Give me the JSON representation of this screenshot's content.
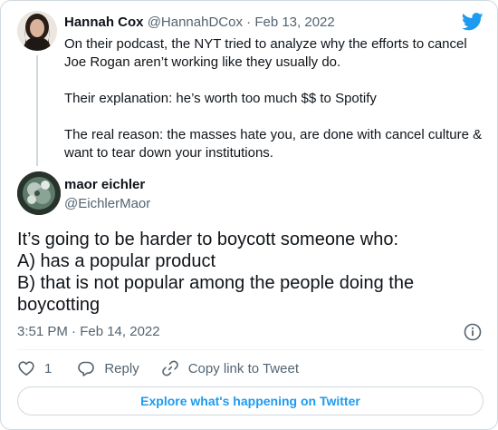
{
  "parent_tweet": {
    "name": "Hannah Cox",
    "handle": "@HannahDCox",
    "separator": "·",
    "date": "Feb 13, 2022",
    "paragraphs": [
      "On their podcast, the NYT tried to analyze why the efforts to cancel Joe Rogan aren’t working like they usually do.",
      "Their explanation: he’s worth too much $$ to Spotify",
      "The real reason: the masses hate you, are done with cancel culture & want to tear down your institutions."
    ]
  },
  "main_tweet": {
    "name": "maor eichler",
    "handle": "@EichlerMaor",
    "lines": [
      "It’s going to be harder to boycott someone who:",
      "A) has a popular product",
      "B) that is not popular among the people doing the boycotting"
    ],
    "time": "3:51 PM · Feb 14, 2022"
  },
  "actions": {
    "like_count": "1",
    "reply_label": "Reply",
    "copy_label": "Copy link to Tweet"
  },
  "explore_label": "Explore what's happening on Twitter",
  "icons": {
    "brand": "twitter-bird-icon",
    "info": "info-icon",
    "like": "heart-icon",
    "reply": "reply-icon",
    "copy": "link-icon"
  },
  "colors": {
    "brand_blue": "#1d9bf0",
    "text": "#0f1419",
    "secondary": "#536471",
    "border": "#cfd9de"
  }
}
